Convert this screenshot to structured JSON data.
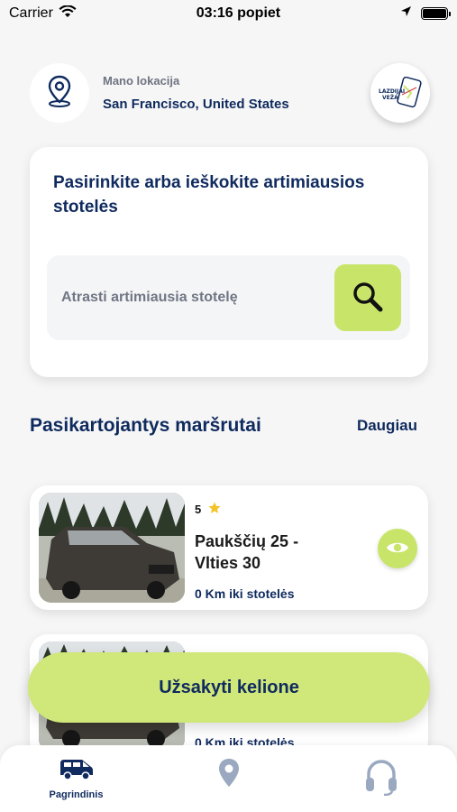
{
  "status_bar": {
    "carrier": "Carrier",
    "time": "03:16 popiet"
  },
  "location": {
    "label": "Mano lokacija",
    "value": "San Francisco, United States"
  },
  "logo": {
    "text_line1": "LAZDIJAI",
    "text_line2": "VEŽA"
  },
  "search": {
    "title": "Pasirinkite arba ieškokite artimiausios stotelės",
    "placeholder": "Atrasti artimiausia stotelę"
  },
  "routes_section": {
    "title": "Pasikartojantys maršrutai",
    "more_label": "Daugiau"
  },
  "routes": [
    {
      "rating": "5",
      "name": "Paukščių 25 - Vlties 30",
      "distance": "0 Km iki stotelės"
    },
    {
      "rating": "",
      "name": "",
      "distance": "0 Km iki stotelės"
    }
  ],
  "order_button": {
    "label": "Užsakyti kelione"
  },
  "tabs": [
    {
      "id": "home",
      "label": "Pagrindinis",
      "icon": "van-icon",
      "active": true
    },
    {
      "id": "map",
      "label": "",
      "icon": "location-pin-icon",
      "active": false
    },
    {
      "id": "support",
      "label": "",
      "icon": "headphones-icon",
      "active": false
    }
  ],
  "colors": {
    "primary_text": "#0f2a5e",
    "accent": "#c8e56a",
    "background": "#f6f6f6",
    "inactive_icon": "#9aa9c0"
  }
}
